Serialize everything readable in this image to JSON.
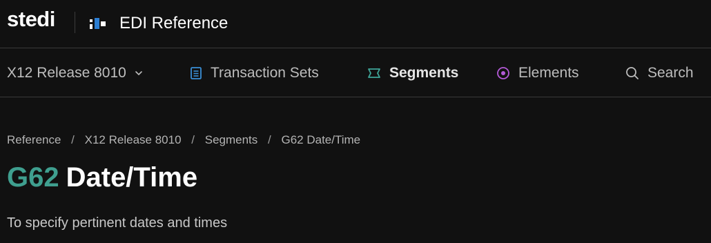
{
  "header": {
    "logo_text": "stedi",
    "product_title": "EDI Reference"
  },
  "nav": {
    "release_label": "X12 Release 8010",
    "items": [
      {
        "label": "Transaction Sets",
        "icon": "document-list-icon",
        "color": "#3a8fd6"
      },
      {
        "label": "Segments",
        "icon": "segment-ribbon-icon",
        "color": "#3fa79a"
      },
      {
        "label": "Elements",
        "icon": "target-circle-icon",
        "color": "#b45ad8"
      }
    ],
    "search_label": "Search"
  },
  "breadcrumb": [
    "Reference",
    "X12 Release 8010",
    "Segments",
    "G62 Date/Time"
  ],
  "page": {
    "code": "G62",
    "name": "Date/Time",
    "description": "To specify pertinent dates and times"
  },
  "colors": {
    "background": "#111111",
    "accent_teal": "#3f9f8f",
    "divider": "#3a3a3a"
  }
}
